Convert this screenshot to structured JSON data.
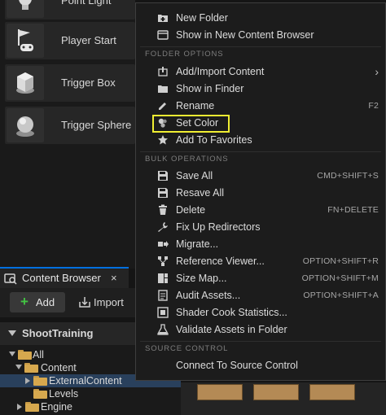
{
  "actors_panel": {
    "items": [
      {
        "label": "Point Light",
        "icon": "lightbulb-icon"
      },
      {
        "label": "Player Start",
        "icon": "player-start-icon"
      },
      {
        "label": "Trigger Box",
        "icon": "trigger-box-icon"
      },
      {
        "label": "Trigger Sphere",
        "icon": "trigger-sphere-icon"
      }
    ]
  },
  "content_browser": {
    "tab_title": "Content Browser",
    "tab_close": "×",
    "toolbar": {
      "add_label": "Add",
      "import_label": "Import"
    },
    "tree": {
      "project_name": "ShootTraining",
      "items": [
        {
          "label": "All",
          "expanded": true
        },
        {
          "label": "Content",
          "expanded": true
        },
        {
          "label": "ExternalContent",
          "expanded": false,
          "selected": true
        },
        {
          "label": "Levels",
          "expanded": false
        },
        {
          "label": "Engine",
          "expanded": false
        }
      ]
    }
  },
  "context_menu": {
    "top_items": [
      {
        "label": "New Folder",
        "icon": "new-folder-icon"
      },
      {
        "label": "Show in New Content Browser",
        "icon": "content-browser-icon"
      }
    ],
    "folder_options": {
      "header": "FOLDER OPTIONS",
      "items": [
        {
          "label": "Add/Import Content",
          "icon": "add-import-icon",
          "submenu": true
        },
        {
          "label": "Show in Finder",
          "icon": "folder-icon"
        },
        {
          "label": "Rename",
          "icon": "rename-icon",
          "shortcut": "F2"
        },
        {
          "label": "Set Color",
          "icon": "color-icon",
          "highlighted": true
        },
        {
          "label": "Add To Favorites",
          "icon": "star-icon"
        }
      ]
    },
    "bulk_operations": {
      "header": "BULK OPERATIONS",
      "items": [
        {
          "label": "Save All",
          "icon": "save-icon",
          "shortcut": "CMD+SHIFT+S"
        },
        {
          "label": "Resave All",
          "icon": "save-icon"
        },
        {
          "label": "Delete",
          "icon": "trash-icon",
          "shortcut": "FN+DELETE"
        },
        {
          "label": "Fix Up Redirectors",
          "icon": "wrench-icon"
        },
        {
          "label": "Migrate...",
          "icon": "migrate-icon"
        },
        {
          "label": "Reference Viewer...",
          "icon": "reference-viewer-icon",
          "shortcut": "OPTION+SHIFT+R"
        },
        {
          "label": "Size Map...",
          "icon": "size-map-icon",
          "shortcut": "OPTION+SHIFT+M"
        },
        {
          "label": "Audit Assets...",
          "icon": "audit-icon",
          "shortcut": "OPTION+SHIFT+A"
        },
        {
          "label": "Shader Cook Statistics...",
          "icon": "shader-stats-icon"
        },
        {
          "label": "Validate Assets in Folder",
          "icon": "flask-icon"
        }
      ]
    },
    "source_control": {
      "header": "SOURCE CONTROL",
      "items": [
        {
          "label": "Connect To Source Control",
          "icon": ""
        }
      ]
    }
  },
  "colors": {
    "highlight": "#f0ee32",
    "selection": "#29405c",
    "active_tab": "#0070e0",
    "add_plus": "#43c443",
    "folder": "#d6a84e"
  }
}
